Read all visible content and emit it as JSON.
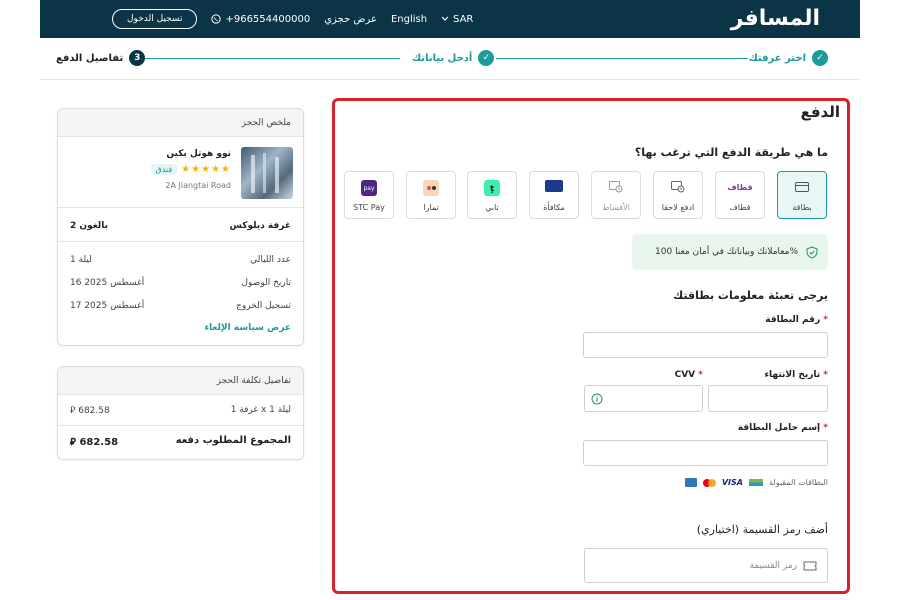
{
  "header": {
    "logo_text": "المسافر",
    "login_label": "تسجيل الدخول",
    "phone": "+966554400000",
    "my_booking": "عرض حجزي",
    "language": "English",
    "currency": "SAR"
  },
  "steps": [
    {
      "num": "1",
      "label": "اختر غرفتك",
      "state": "done"
    },
    {
      "num": "2",
      "label": "أدخل بياناتك",
      "state": "done"
    },
    {
      "num": "3",
      "label": "تفاصيل الدفع",
      "state": "active"
    }
  ],
  "booking_summary": {
    "title": "ملخص الحجز",
    "hotel_name": "نوو هوتل بكين",
    "stars": 5,
    "type_badge": "فندق",
    "address": "2A Jiangtai Road",
    "room_type": "غرفة ديلوكس",
    "guests": "2 بالغون",
    "nights_label": "عدد الليالي",
    "nights_value": "1 ليلة",
    "checkin_label": "تاريخ الوصول",
    "checkin_value": "16 أغسطس 2025",
    "checkout_label": "تسجيل الخروج",
    "checkout_value": "17 أغسطس 2025",
    "cancel_policy_link": "عرض سياسة الإلغاء"
  },
  "cost": {
    "title": "تفاصيل تكلفة الحجز",
    "line_label": "1 غرفة x 1 ليلة",
    "line_value": "682.58",
    "total_label": "المجموع المطلوب دفعه",
    "total_value": "682.58",
    "currency_symbol": "⃁"
  },
  "payment": {
    "title": "الدفع",
    "question": "ما هي طريقة الدفع التي ترغب بها؟",
    "methods": [
      {
        "label": "بطاقة",
        "icon": "card-icon",
        "selected": true
      },
      {
        "label": "قطاف",
        "icon": "qitaf-icon",
        "selected": false
      },
      {
        "label": "ادفع لاحقا",
        "icon": "clock-card-icon",
        "selected": false
      },
      {
        "label": "الأقساط",
        "icon": "installments-icon",
        "selected": false
      },
      {
        "label": "مكافأة",
        "icon": "mokafaa-icon",
        "selected": false
      },
      {
        "label": "تابي",
        "icon": "tabby-icon",
        "selected": false
      },
      {
        "label": "تمارا",
        "icon": "tamara-icon",
        "selected": false
      },
      {
        "label": "STC Pay",
        "icon": "stcpay-icon",
        "selected": false
      }
    ],
    "secure_text": "معاملاتك وبياناتك في أمان معنا 100%",
    "form_title": "يرجى تعبئة معلومات بطاقتك",
    "card_number_label": "رقم البطاقة",
    "expiry_label": "تاريخ الانتهاء",
    "cvv_label": "CVV",
    "holder_label": "إسم حامل البطاقة",
    "accepted_cards": "البطاقات المقبولة",
    "coupon_title": "أضف رمز القسيمة (اختياري)",
    "coupon_placeholder": "رمز القسيمة",
    "tabby_glyph": "ṯ",
    "stc_glyph": "pay"
  },
  "colors": {
    "header_bg": "#0b3447",
    "accent": "#1d9a9e",
    "highlight_border": "#d8232a",
    "logo_red": "#e0313c"
  }
}
